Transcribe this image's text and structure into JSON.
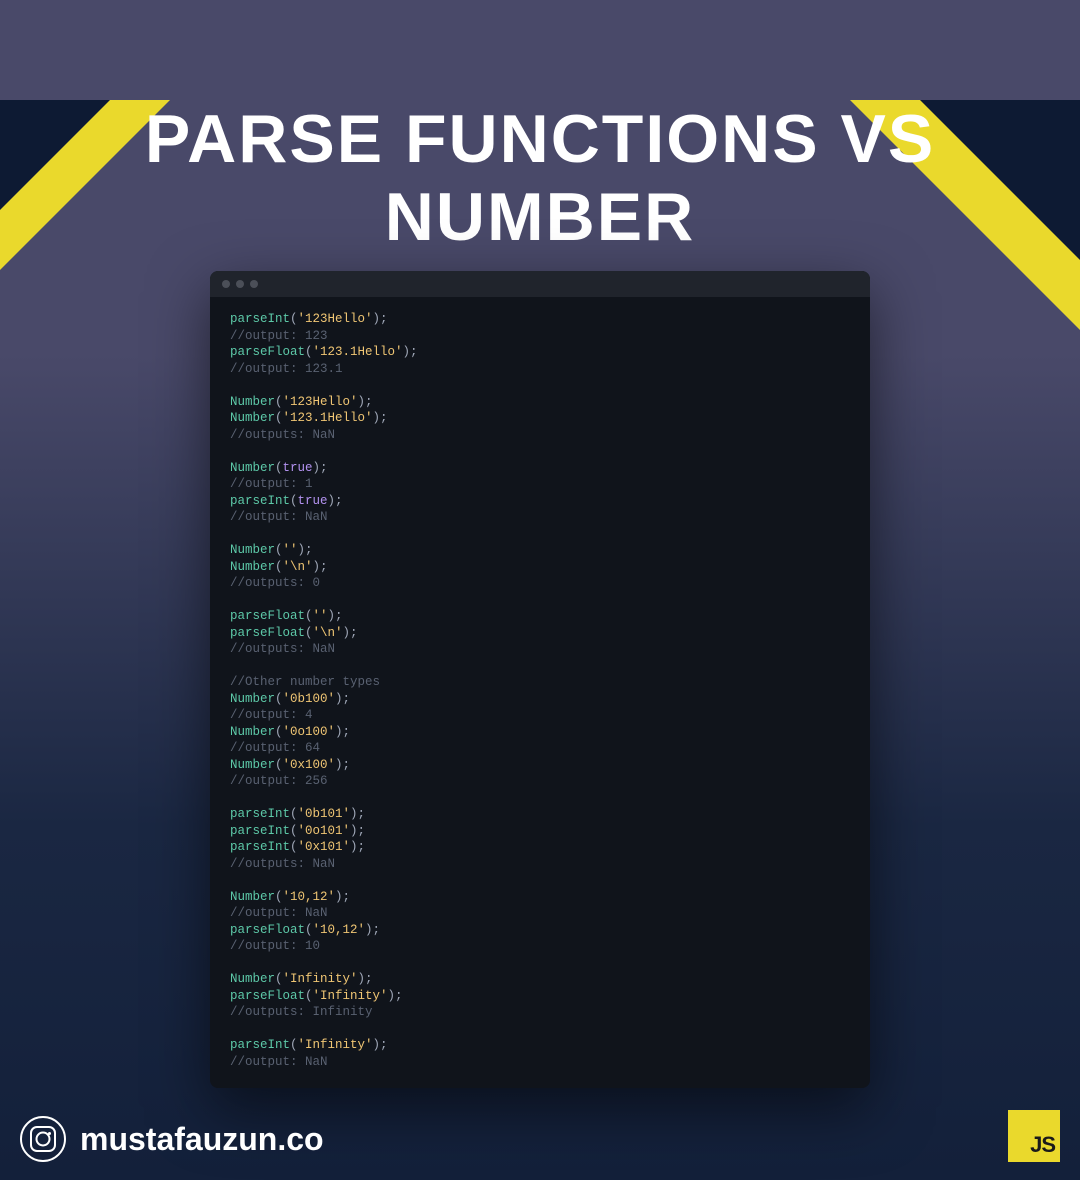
{
  "title": "PARSE FUNCTIONS VS NUMBER",
  "footer": {
    "handle": "mustafauzun.co",
    "badge": "JS"
  },
  "code": {
    "lines": [
      [
        {
          "c": "fn",
          "t": "parseInt"
        },
        {
          "c": "pn",
          "t": "("
        },
        {
          "c": "str",
          "t": "'123Hello'"
        },
        {
          "c": "pn",
          "t": ");"
        }
      ],
      [
        {
          "c": "cm",
          "t": "//output: 123"
        }
      ],
      [
        {
          "c": "fn",
          "t": "parseFloat"
        },
        {
          "c": "pn",
          "t": "("
        },
        {
          "c": "str",
          "t": "'123.1Hello'"
        },
        {
          "c": "pn",
          "t": ");"
        }
      ],
      [
        {
          "c": "cm",
          "t": "//output: 123.1"
        }
      ],
      "blank",
      [
        {
          "c": "fn",
          "t": "Number"
        },
        {
          "c": "pn",
          "t": "("
        },
        {
          "c": "str",
          "t": "'123Hello'"
        },
        {
          "c": "pn",
          "t": ");"
        }
      ],
      [
        {
          "c": "fn",
          "t": "Number"
        },
        {
          "c": "pn",
          "t": "("
        },
        {
          "c": "str",
          "t": "'123.1Hello'"
        },
        {
          "c": "pn",
          "t": ");"
        }
      ],
      [
        {
          "c": "cm",
          "t": "//outputs: NaN"
        }
      ],
      "blank",
      [
        {
          "c": "fn",
          "t": "Number"
        },
        {
          "c": "pn",
          "t": "("
        },
        {
          "c": "kw",
          "t": "true"
        },
        {
          "c": "pn",
          "t": ");"
        }
      ],
      [
        {
          "c": "cm",
          "t": "//output: 1"
        }
      ],
      [
        {
          "c": "fn",
          "t": "parseInt"
        },
        {
          "c": "pn",
          "t": "("
        },
        {
          "c": "kw",
          "t": "true"
        },
        {
          "c": "pn",
          "t": ");"
        }
      ],
      [
        {
          "c": "cm",
          "t": "//output: NaN"
        }
      ],
      "blank",
      [
        {
          "c": "fn",
          "t": "Number"
        },
        {
          "c": "pn",
          "t": "("
        },
        {
          "c": "str",
          "t": "''"
        },
        {
          "c": "pn",
          "t": ");"
        }
      ],
      [
        {
          "c": "fn",
          "t": "Number"
        },
        {
          "c": "pn",
          "t": "("
        },
        {
          "c": "str",
          "t": "'\\n'"
        },
        {
          "c": "pn",
          "t": ");"
        }
      ],
      [
        {
          "c": "cm",
          "t": "//outputs: 0"
        }
      ],
      "blank",
      [
        {
          "c": "fn",
          "t": "parseFloat"
        },
        {
          "c": "pn",
          "t": "("
        },
        {
          "c": "str",
          "t": "''"
        },
        {
          "c": "pn",
          "t": ");"
        }
      ],
      [
        {
          "c": "fn",
          "t": "parseFloat"
        },
        {
          "c": "pn",
          "t": "("
        },
        {
          "c": "str",
          "t": "'\\n'"
        },
        {
          "c": "pn",
          "t": ");"
        }
      ],
      [
        {
          "c": "cm",
          "t": "//outputs: NaN"
        }
      ],
      "blank",
      [
        {
          "c": "cm",
          "t": "//Other number types"
        }
      ],
      [
        {
          "c": "fn",
          "t": "Number"
        },
        {
          "c": "pn",
          "t": "("
        },
        {
          "c": "str",
          "t": "'0b100'"
        },
        {
          "c": "pn",
          "t": ");"
        }
      ],
      [
        {
          "c": "cm",
          "t": "//output: 4"
        }
      ],
      [
        {
          "c": "fn",
          "t": "Number"
        },
        {
          "c": "pn",
          "t": "("
        },
        {
          "c": "str",
          "t": "'0o100'"
        },
        {
          "c": "pn",
          "t": ");"
        }
      ],
      [
        {
          "c": "cm",
          "t": "//output: 64"
        }
      ],
      [
        {
          "c": "fn",
          "t": "Number"
        },
        {
          "c": "pn",
          "t": "("
        },
        {
          "c": "str",
          "t": "'0x100'"
        },
        {
          "c": "pn",
          "t": ");"
        }
      ],
      [
        {
          "c": "cm",
          "t": "//output: 256"
        }
      ],
      "blank",
      [
        {
          "c": "fn",
          "t": "parseInt"
        },
        {
          "c": "pn",
          "t": "("
        },
        {
          "c": "str",
          "t": "'0b101'"
        },
        {
          "c": "pn",
          "t": ");"
        }
      ],
      [
        {
          "c": "fn",
          "t": "parseInt"
        },
        {
          "c": "pn",
          "t": "("
        },
        {
          "c": "str",
          "t": "'0o101'"
        },
        {
          "c": "pn",
          "t": ");"
        }
      ],
      [
        {
          "c": "fn",
          "t": "parseInt"
        },
        {
          "c": "pn",
          "t": "("
        },
        {
          "c": "str",
          "t": "'0x101'"
        },
        {
          "c": "pn",
          "t": ");"
        }
      ],
      [
        {
          "c": "cm",
          "t": "//outputs: NaN"
        }
      ],
      "blank",
      [
        {
          "c": "fn",
          "t": "Number"
        },
        {
          "c": "pn",
          "t": "("
        },
        {
          "c": "str",
          "t": "'10,12'"
        },
        {
          "c": "pn",
          "t": ");"
        }
      ],
      [
        {
          "c": "cm",
          "t": "//output: NaN"
        }
      ],
      [
        {
          "c": "fn",
          "t": "parseFloat"
        },
        {
          "c": "pn",
          "t": "("
        },
        {
          "c": "str",
          "t": "'10,12'"
        },
        {
          "c": "pn",
          "t": ");"
        }
      ],
      [
        {
          "c": "cm",
          "t": "//output: 10"
        }
      ],
      "blank",
      [
        {
          "c": "fn",
          "t": "Number"
        },
        {
          "c": "pn",
          "t": "("
        },
        {
          "c": "str",
          "t": "'Infinity'"
        },
        {
          "c": "pn",
          "t": ");"
        }
      ],
      [
        {
          "c": "fn",
          "t": "parseFloat"
        },
        {
          "c": "pn",
          "t": "("
        },
        {
          "c": "str",
          "t": "'Infinity'"
        },
        {
          "c": "pn",
          "t": ");"
        }
      ],
      [
        {
          "c": "cm",
          "t": "//outputs: Infinity"
        }
      ],
      "blank",
      [
        {
          "c": "fn",
          "t": "parseInt"
        },
        {
          "c": "pn",
          "t": "("
        },
        {
          "c": "str",
          "t": "'Infinity'"
        },
        {
          "c": "pn",
          "t": ");"
        }
      ],
      [
        {
          "c": "cm",
          "t": "//output: NaN"
        }
      ]
    ]
  }
}
